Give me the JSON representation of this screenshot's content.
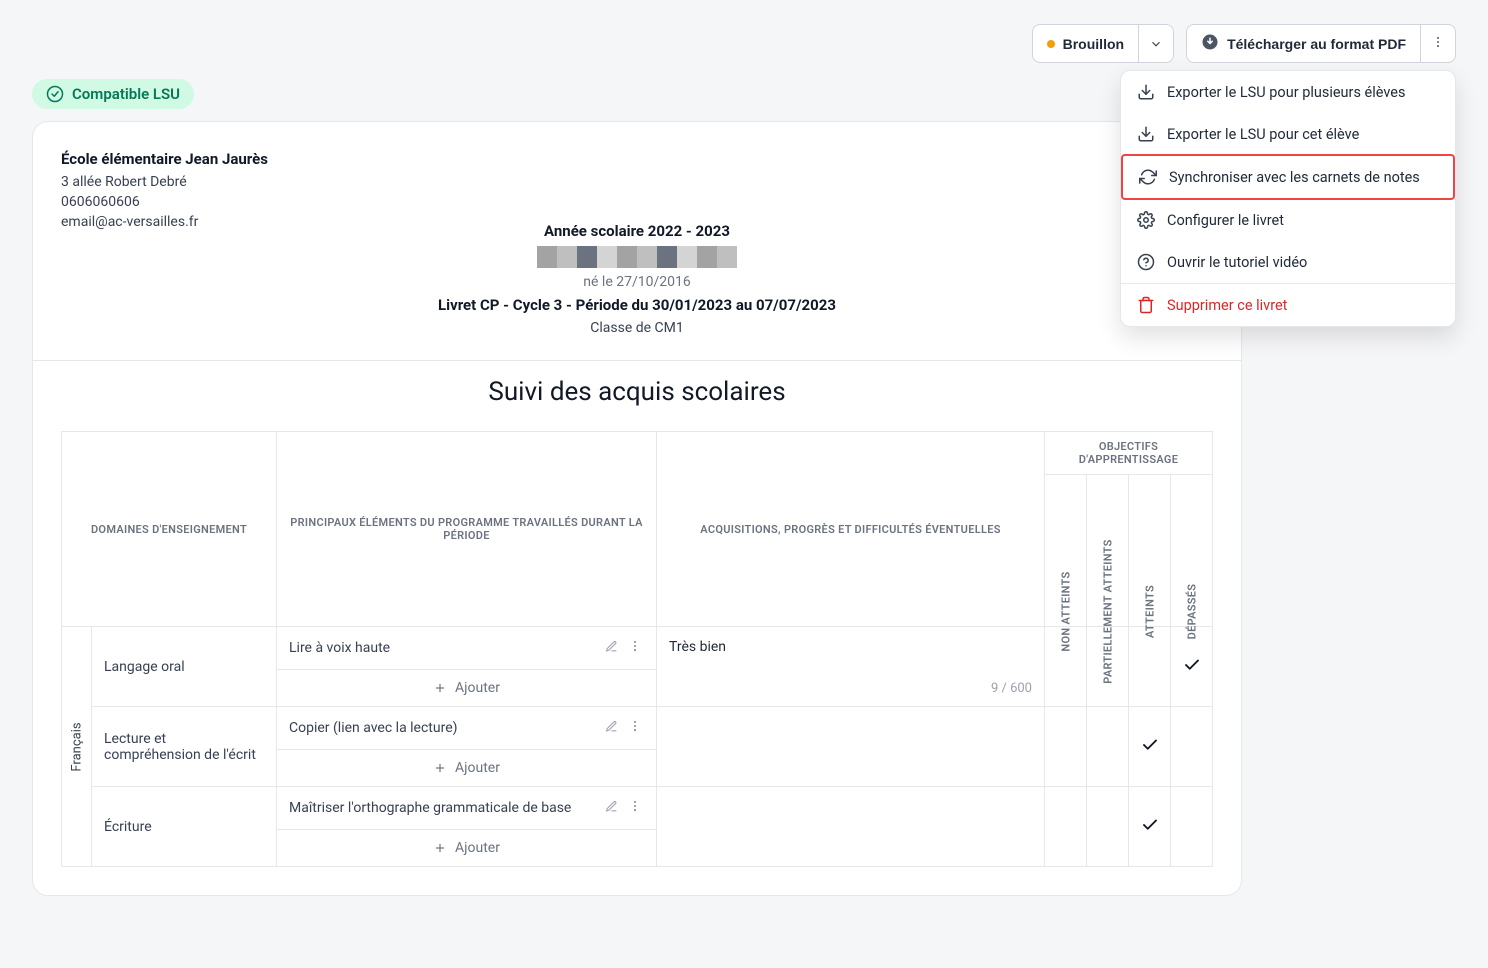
{
  "toolbar": {
    "status_label": "Brouillon",
    "download_label": "Télécharger au format PDF"
  },
  "badge": {
    "label": "Compatible LSU"
  },
  "school": {
    "name": "École élémentaire Jean Jaurès",
    "address": "3 allée Robert Debré",
    "phone": "0606060606",
    "email": "email@ac-versailles.fr"
  },
  "header": {
    "year": "Année scolaire 2022 - 2023",
    "dob": "né le 27/10/2016",
    "livret": "Livret CP - Cycle 3 - Période du 30/01/2023 au 07/07/2023",
    "classe": "Classe de CM1"
  },
  "section_title": "Suivi des acquis scolaires",
  "columns": {
    "col1": "DOMAINES D'ENSEIGNEMENT",
    "col2": "PRINCIPAUX ÉLÉMENTS DU PROGRAMME TRAVAILLÉS DURANT LA PÉRIODE",
    "col3": "ACQUISITIONS, PROGRÈS ET DIFFICULTÉS ÉVENTUELLES",
    "col_obj_header": "OBJECTIFS D'APPRENTISSAGE",
    "obj1": "NON ATTEINTS",
    "obj2": "PARTIELLEMENT ATTEINTS",
    "obj3": "ATTEINTS",
    "obj4": "DÉPASSÉS"
  },
  "domain": "Français",
  "rows": [
    {
      "subdomain": "Langage oral",
      "elements": [
        "Lire à voix haute"
      ],
      "acq_text": "Très bien",
      "acq_count": "9 / 600",
      "checked": 3
    },
    {
      "subdomain": "Lecture et compréhension de l'écrit",
      "elements": [
        "Copier (lien avec la lecture)"
      ],
      "checked": 2
    },
    {
      "subdomain": "Écriture",
      "elements": [
        "Maîtriser l'orthographe grammaticale de base"
      ],
      "checked": 2
    }
  ],
  "add_label": "Ajouter",
  "dropdown": {
    "item1": "Exporter le LSU pour plusieurs élèves",
    "item2": "Exporter le LSU pour cet élève",
    "item3": "Synchroniser avec les carnets de notes",
    "item4": "Configurer le livret",
    "item5": "Ouvrir le tutoriel vidéo",
    "item6": "Supprimer ce livret"
  }
}
